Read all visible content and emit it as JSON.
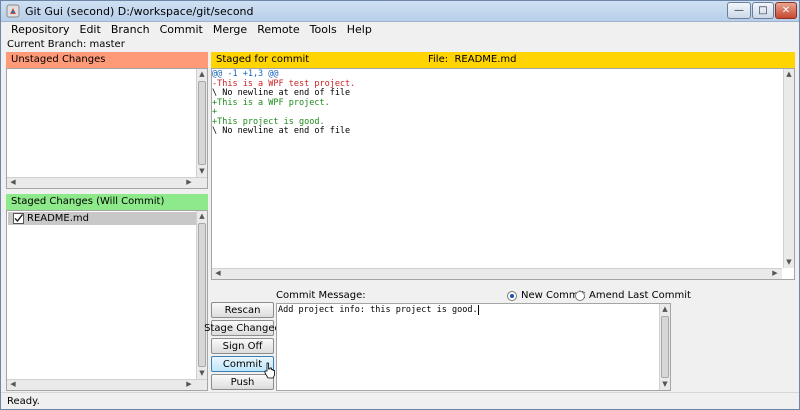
{
  "window": {
    "title": "Git Gui (second) D:/workspace/git/second",
    "controls": {
      "minimize": "—",
      "maximize": "□",
      "close": "✕"
    }
  },
  "menu": [
    "Repository",
    "Edit",
    "Branch",
    "Commit",
    "Merge",
    "Remote",
    "Tools",
    "Help"
  ],
  "branch": {
    "label": "Current Branch: master"
  },
  "unstaged": {
    "header": "Unstaged Changes"
  },
  "staged": {
    "header": "Staged Changes (Will Commit)",
    "files": [
      {
        "name": "README.md",
        "icon": "staged-check-icon"
      }
    ]
  },
  "diff": {
    "header": "Staged for commit",
    "file_label": "File:",
    "file_name": "README.md",
    "lines": [
      {
        "text": "@@ -1 +1,3 @@",
        "kind": "hunk"
      },
      {
        "text": "-This is a WPF test project.",
        "kind": "del"
      },
      {
        "text": "\\ No newline at end of file",
        "kind": "ctx"
      },
      {
        "text": "+This is a WPF project.",
        "kind": "add"
      },
      {
        "text": "+",
        "kind": "add"
      },
      {
        "text": "+This project is good.",
        "kind": "add"
      },
      {
        "text": "\\ No newline at end of file",
        "kind": "ctx"
      }
    ]
  },
  "actions": {
    "rescan": "Rescan",
    "stage_changed": "Stage Changed",
    "sign_off": "Sign Off",
    "commit": "Commit",
    "push": "Push"
  },
  "commit": {
    "label": "Commit Message:",
    "new_commit": "New Commit",
    "amend": "Amend Last Commit",
    "selected": "new_commit",
    "message": "Add project info: this project is good."
  },
  "status": {
    "text": "Ready."
  },
  "colors": {
    "unstaged": "#ff9a78",
    "staged": "#8ee98a",
    "diff_header": "#ffd400",
    "hunk": "#1a66b8",
    "deleted": "#cc2222",
    "added": "#1d8a1d"
  }
}
